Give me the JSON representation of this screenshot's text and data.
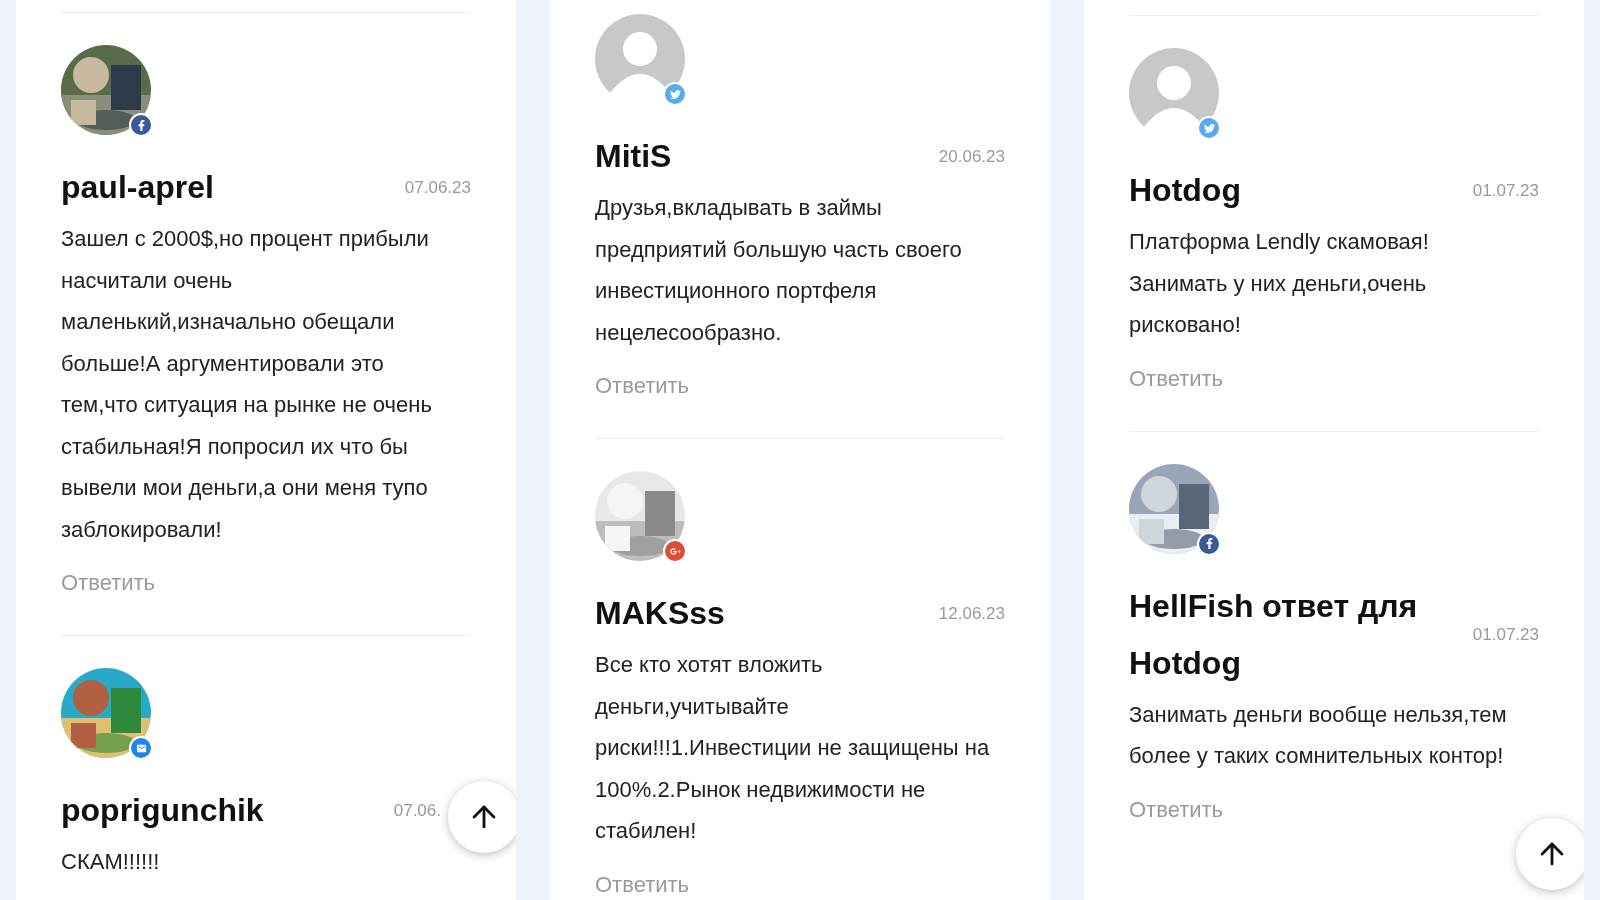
{
  "columns": [
    {
      "top_rule": true,
      "comments": [
        {
          "badge": {
            "kind": "facebook"
          },
          "name": "paul-aprel",
          "date": "07.06.23",
          "text": "Зашел с 2000$,но процент прибыли насчитали очень маленький,изначально обещали больше!А аргументировали это тем,что ситуация на рынке не очень стабильная!Я попросил их что бы вывели мои деньги,а они меня тупо заблокировали!",
          "reply": "Ответить"
        },
        {
          "badge": {
            "kind": "mail"
          },
          "name": "poprigunchik",
          "date": "07.06.",
          "text": "СКАМ!!!!!!"
        }
      ]
    },
    {
      "top_rule": false,
      "comments": [
        {
          "avatar": {
            "kind": "default"
          },
          "badge": {
            "kind": "twitter"
          },
          "name": "MitiS",
          "date": "20.06.23",
          "text": "Друзья,вкладывать в займы предприятий большую часть своего инвестиционного портфеля нецелесообразно.",
          "reply": "Ответить"
        },
        {
          "badge": {
            "kind": "google"
          },
          "name": "MAKSss",
          "date": "12.06.23",
          "text": "Все кто хотят вложить деньги,учитывайте риски!!!1.Инвестиции не защищены на 100%.2.Рынок недвижимости не стабилен!",
          "reply": "Ответить"
        }
      ]
    },
    {
      "top_rule": true,
      "comments": [
        {
          "avatar": {
            "kind": "default"
          },
          "badge": {
            "kind": "twitter"
          },
          "name": "Hotdog",
          "date": "01.07.23",
          "text": "Платформа Lendly скамовая! Занимать у них деньги,очень рисковано!",
          "reply": "Ответить"
        },
        {
          "badge": {
            "kind": "facebook"
          },
          "name": "HellFish ответ для Hotdog",
          "date": "01.07.23",
          "text": "Занимать деньги вообще нельзя,тем более у таких сомнительных контор!",
          "reply": "Ответить"
        }
      ]
    }
  ]
}
